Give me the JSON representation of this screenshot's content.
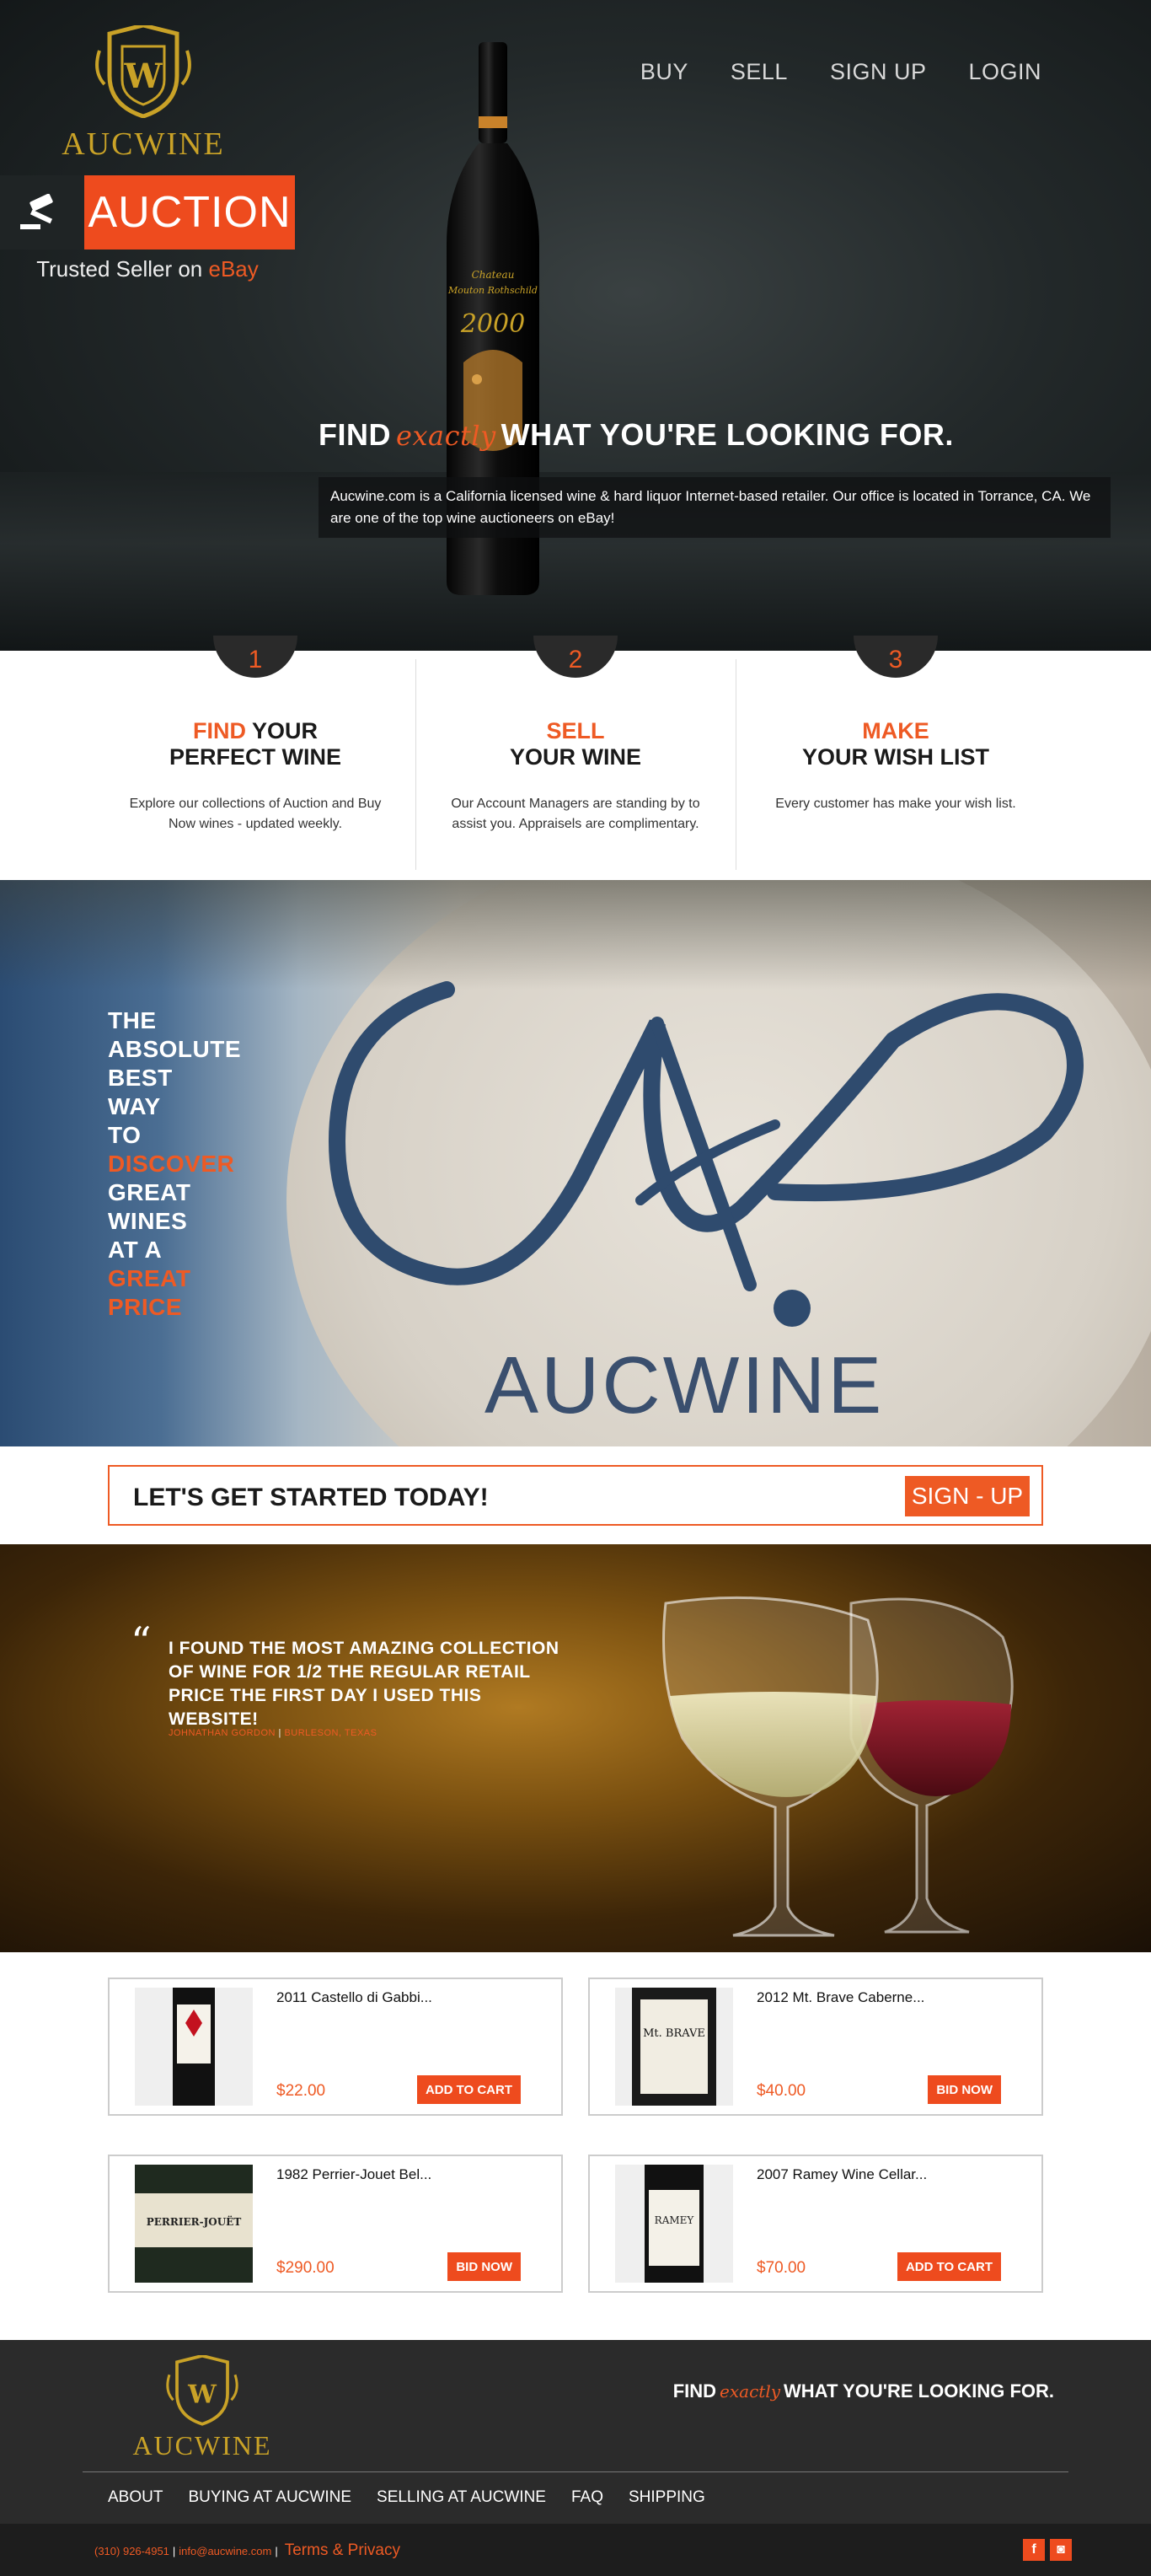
{
  "brand": {
    "name": "AUCWINE",
    "crest_letter": "W",
    "gold": "#c9a227",
    "accent": "#ee5a24"
  },
  "nav": [
    {
      "label": "BUY"
    },
    {
      "label": "SELL"
    },
    {
      "label": "SIGN UP"
    },
    {
      "label": "LOGIN"
    }
  ],
  "hero": {
    "auction_label": "AUCTION",
    "auction_icon": "gavel-icon",
    "trusted_prefix": "Trusted Seller on",
    "trusted_ebay": "eBay",
    "headline_pre": "FIND",
    "headline_script": "exactly",
    "headline_post": "WHAT YOU'RE LOOKING FOR.",
    "description": "Aucwine.com is a California licensed wine & hard liquor Internet-based retailer. Our office is located in Torrance, CA. We are one of the top wine auctioneers on eBay!",
    "bottle_label": {
      "line1": "Chateau",
      "line2": "Mouton Rothschild",
      "year": "2000"
    }
  },
  "steps": [
    {
      "num": "1",
      "accent": "FIND",
      "rest": "YOUR",
      "line2": "PERFECT WINE",
      "text": "Explore our collections of Auction and Buy Now wines - updated weekly."
    },
    {
      "num": "2",
      "accent": "SELL",
      "rest": "",
      "line2": "YOUR WINE",
      "text": "Our Account Managers are standing by to assist you. Appraisels are complimentary."
    },
    {
      "num": "3",
      "accent": "MAKE",
      "rest": "",
      "line2": "YOUR WISH LIST",
      "text": "Every customer has make your wish list."
    }
  ],
  "banner": {
    "l1": "THE",
    "l2": "ABSOLUTE",
    "l3": "BEST",
    "l4": "WAY",
    "l5": "TO",
    "l6": "DISCOVER",
    "l7": "GREAT",
    "l8": "WINES",
    "l9": "AT A",
    "l10": "GREAT",
    "l11": "PRICE",
    "coaster_word": "AUCWINE"
  },
  "cta": {
    "text": "LET'S GET STARTED TODAY!",
    "button": "SIGN - UP"
  },
  "testimonial": {
    "mark": "“",
    "quote": "I FOUND THE MOST AMAZING COLLECTION OF WINE FOR 1/2 THE REGULAR RETAIL PRICE THE FIRST DAY I USED THIS WEBSITE!",
    "author": "JOHNATHAN GORDON",
    "separator": "|",
    "location": "BURLESON, TEXAS"
  },
  "products": [
    {
      "name": "2011 Castello di Gabbi...",
      "price": "$22.00",
      "button": "ADD TO CART",
      "label_text": ""
    },
    {
      "name": "2012 Mt. Brave Caberne...",
      "price": "$40.00",
      "button": "BID NOW",
      "label_text": "Mt. BRAVE"
    },
    {
      "name": "1982 Perrier-Jouet Bel...",
      "price": "$290.00",
      "button": "BID NOW",
      "label_text": "PERRIER-JOUËT"
    },
    {
      "name": "2007 Ramey Wine Cellar...",
      "price": "$70.00",
      "button": "ADD TO CART",
      "label_text": "RAMEY"
    }
  ],
  "footer": {
    "tagline_pre": "FIND",
    "tagline_script": "exactly",
    "tagline_post": "WHAT YOU'RE LOOKING FOR.",
    "nav": [
      {
        "label": "ABOUT"
      },
      {
        "label": "BUYING AT AUCWINE"
      },
      {
        "label": "SELLING AT AUCWINE"
      },
      {
        "label": "FAQ"
      },
      {
        "label": "SHIPPING"
      }
    ],
    "phone": "(310) 926-4951",
    "email": "info@aucwine.com",
    "separator": "|",
    "terms": "Terms & Privacy",
    "social": [
      {
        "icon": "facebook-icon",
        "glyph": "f"
      },
      {
        "icon": "instagram-icon",
        "glyph": "◙"
      }
    ]
  }
}
